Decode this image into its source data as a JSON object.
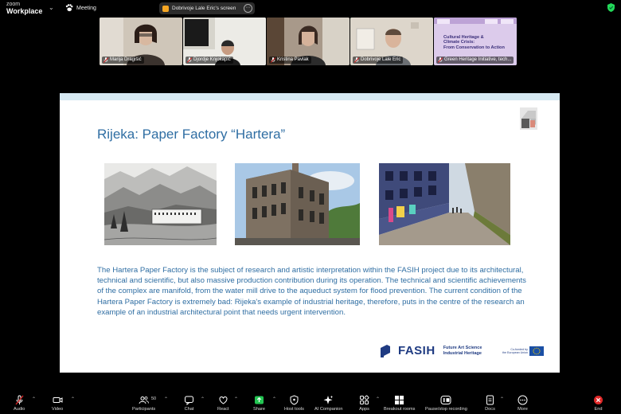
{
  "app": {
    "brand_line1": "zoom",
    "brand_line2": "Workplace",
    "meeting_label": "Meeting",
    "share_indicator": "Dobrivoje Lale Eric's screen"
  },
  "participants": [
    {
      "name": "Marija Dragišić"
    },
    {
      "name": "Djordje Knjokapić"
    },
    {
      "name": "Kristina Pavlak"
    },
    {
      "name": "Dobrivoje Lale Eric"
    },
    {
      "name": "Green Heritage Initiative, tech..."
    }
  ],
  "gh_card": {
    "line1": "Cultural Heritage &",
    "line2": "Climate Crisis:",
    "line3": "From Conservation to Action"
  },
  "slide": {
    "title": "Rijeka: Paper Factory “Hartera”",
    "body": "The Hartera Paper Factory is the subject of research and artistic interpretation within the FASIH project due to its architectural, technical and scientific, but also massive production contribution during its operation. The technical and scientific achievements of the complex are manifold, from the water mill drive to the aqueduct system for flood prevention. The current condition of the Hartera Paper Factory is extremely bad: Rijeka's example of industrial heritage, therefore, puts in the centre of the research an example of an industrial architectural point that needs urgent intervention.",
    "logo_word": "FASIH",
    "logo_sub1": "Future Art Science",
    "logo_sub2": "Industrial Heritage",
    "eu_line1": "Co-funded by",
    "eu_line2": "the European Union"
  },
  "toolbar": {
    "audio": "Audio",
    "video": "Video",
    "participants": "Participants",
    "participants_count": "50",
    "chat": "Chat",
    "react": "React",
    "share": "Share",
    "host_tools": "Host tools",
    "ai_companion": "AI Companion",
    "apps": "Apps",
    "breakout_rooms": "Breakout rooms",
    "pause_recording": "Pause/stop recording",
    "docs": "Docs",
    "more": "More",
    "end": "End"
  },
  "colors": {
    "accent_green": "#23d959",
    "slide_text": "#2f6ea3",
    "end_red": "#e02828"
  }
}
